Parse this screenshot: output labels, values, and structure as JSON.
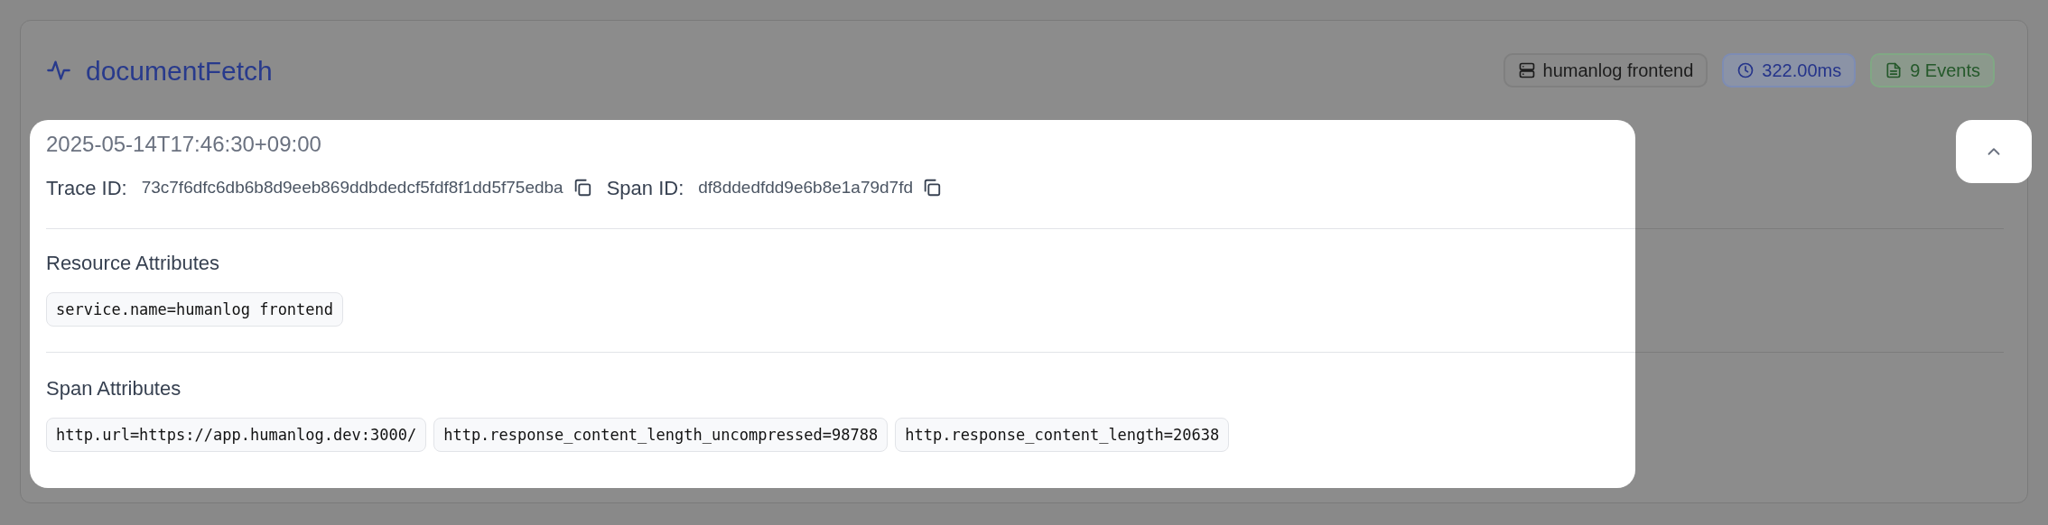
{
  "header": {
    "title": "documentFetch",
    "badges": [
      {
        "kind": "service",
        "text": "humanlog frontend"
      },
      {
        "kind": "duration",
        "text": "322.00ms"
      },
      {
        "kind": "events",
        "text": "9 Events"
      }
    ]
  },
  "details": {
    "timestamp": "2025-05-14T17:46:30+09:00",
    "ids": [
      {
        "label": "Trace ID:",
        "value": "73c7f6dfc6db6b8d9eeb869ddbdedcf5fdf8f1dd5f75edba"
      },
      {
        "label": "Span ID:",
        "value": "df8ddedfdd9e6b8e1a79d7fd"
      }
    ],
    "sections": [
      {
        "title": "Resource Attributes",
        "attributes": [
          "service.name=humanlog frontend"
        ]
      },
      {
        "title": "Span Attributes",
        "attributes": [
          "http.url=https://app.humanlog.dev:3000/",
          "http.response_content_length_uncompressed=98788",
          "http.response_content_length=20638"
        ]
      }
    ]
  },
  "collapse_button": {
    "expanded": true
  }
}
